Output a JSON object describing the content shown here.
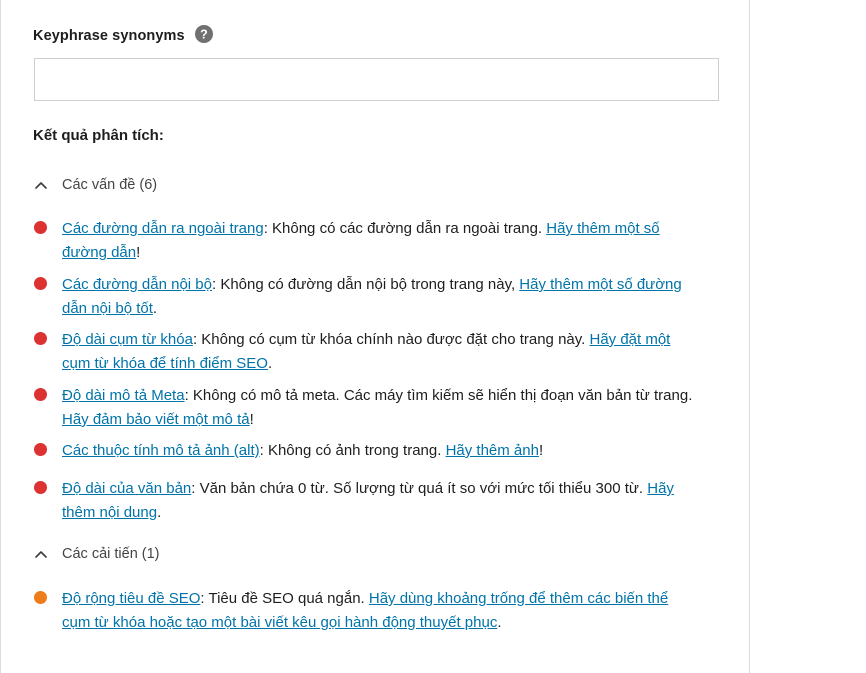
{
  "synonyms": {
    "label": "Keyphrase synonyms",
    "value": "",
    "placeholder": ""
  },
  "analysis": {
    "title": "Kết quả phân tích:",
    "problems_section": "Các vấn đề (6)",
    "improvements_section": "Các cải tiến (1)",
    "colors": {
      "problem": "#dc3232",
      "improvement": "#ee7c1b",
      "link": "#0073aa"
    },
    "problems": [
      {
        "title": "Các đường dẫn ra ngoài trang",
        "text": ": Không có các đường dẫn ra ngoài trang. ",
        "action": "Hãy thêm một số đường dẫn",
        "end": "!"
      },
      {
        "title": "Các đường dẫn nội bộ",
        "text": ": Không có đường dẫn nội bộ trong trang này, ",
        "action": "Hãy thêm một số đường dẫn nội bộ tốt",
        "end": "."
      },
      {
        "title": "Độ dài cụm từ khóa",
        "text": ": Không có cụm từ khóa chính nào được đặt cho trang này. ",
        "action": "Hãy đặt một cụm từ khóa để tính điểm SEO",
        "end": "."
      },
      {
        "title": "Độ dài mô tả Meta",
        "text": ": Không có mô tả meta. Các máy tìm kiếm sẽ hiển thị đoạn văn bản từ trang. ",
        "action": "Hãy đảm bảo viết một mô tả",
        "end": "!"
      },
      {
        "title": "Các thuộc tính mô tả ảnh (alt)",
        "text": ": Không có ảnh trong trang. ",
        "action": "Hãy thêm ảnh",
        "end": "!"
      },
      {
        "title": "Độ dài của văn bản",
        "text": ": Văn bản chứa 0 từ. Số lượng từ quá ít so với mức tối thiểu 300 từ. ",
        "action": "Hãy thêm nội dung",
        "end": "."
      }
    ],
    "improvements": [
      {
        "title": "Độ rộng tiêu đề SEO",
        "text": ": Tiêu đề SEO quá ngắn. ",
        "action": "Hãy dùng khoảng trống để thêm các biến thể cụm từ khóa hoặc tạo một bài viết kêu gọi hành động thuyết phục",
        "end": "."
      }
    ]
  }
}
